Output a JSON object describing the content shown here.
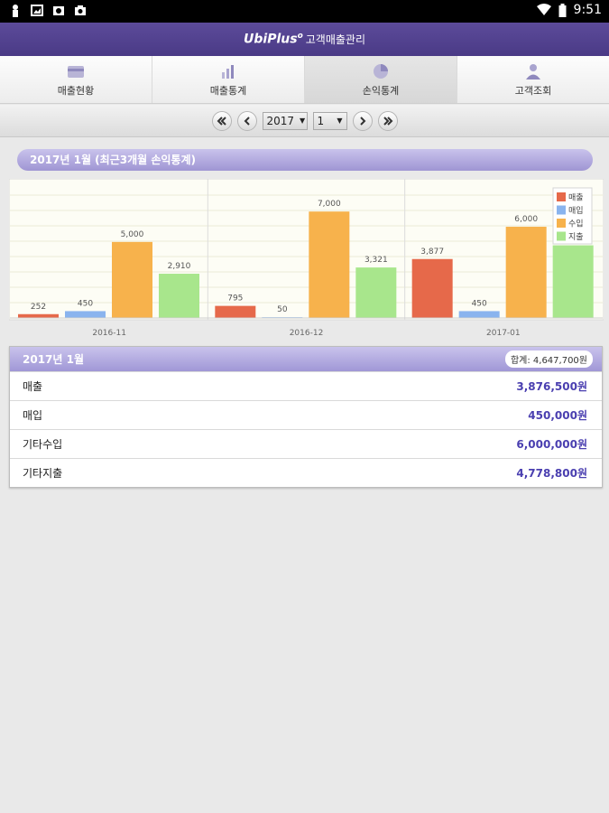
{
  "status_bar": {
    "time": "9:51",
    "left_icons": [
      "notification-icon",
      "image-icon",
      "photo-icon",
      "camera-icon"
    ],
    "right_icons": [
      "wifi-icon",
      "battery-icon"
    ]
  },
  "app": {
    "brand": "UbiPlus",
    "brand_mark": "o",
    "title": "고객매출관리"
  },
  "tabs": [
    {
      "label": "매출현황",
      "icon": "card-icon"
    },
    {
      "label": "매출통계",
      "icon": "bar-chart-icon"
    },
    {
      "label": "손익통계",
      "icon": "pie-chart-icon",
      "active": true
    },
    {
      "label": "고객조회",
      "icon": "person-icon"
    }
  ],
  "date_nav": {
    "year": "2017",
    "month": "1"
  },
  "period_title": "2017년 1월 (최근3개월 손익통계)",
  "chart_data": {
    "type": "bar",
    "categories": [
      "2016-11",
      "2016-12",
      "2017-01"
    ],
    "series": [
      {
        "name": "매출",
        "color": "#e6694a",
        "values": [
          252,
          795,
          3877
        ],
        "labels": [
          "252",
          "795",
          "3,877"
        ]
      },
      {
        "name": "매입",
        "color": "#8ab4ee",
        "values": [
          450,
          50,
          450
        ],
        "labels": [
          "450",
          "50",
          "450"
        ]
      },
      {
        "name": "수입",
        "color": "#f7b24c",
        "values": [
          5000,
          7000,
          6000
        ],
        "labels": [
          "5,000",
          "7,000",
          "6,000"
        ]
      },
      {
        "name": "지출",
        "color": "#a8e68c",
        "values": [
          2910,
          3321,
          4779
        ],
        "labels": [
          "2,910",
          "3,321",
          ""
        ]
      }
    ],
    "ylim": [
      0,
      8000
    ],
    "grid": true,
    "legend": "top-right"
  },
  "summary": {
    "title": "2017년 1월",
    "total": "합계: 4,647,700원",
    "rows": [
      {
        "label": "매출",
        "value": "3,876,500원"
      },
      {
        "label": "매입",
        "value": "450,000원"
      },
      {
        "label": "기타수입",
        "value": "6,000,000원"
      },
      {
        "label": "기타지출",
        "value": "4,778,800원"
      }
    ]
  }
}
